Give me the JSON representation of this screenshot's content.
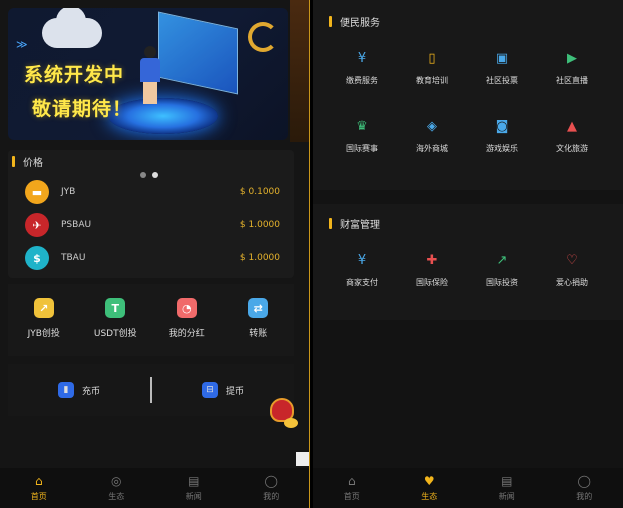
{
  "banner": {
    "line1": "系统开发中",
    "line2": "敬请期待！",
    "slides": 2,
    "active_slide": 1
  },
  "price": {
    "title": "价格",
    "rows": [
      {
        "name": "JYB",
        "price": "$ 0.1000",
        "icon": "jyb-coin-icon",
        "color": "#f2a61c"
      },
      {
        "name": "PSBAU",
        "price": "$ 1.0000",
        "icon": "psbau-coin-icon",
        "color": "#c8262a"
      },
      {
        "name": "TBAU",
        "price": "$ 1.0000",
        "icon": "tbau-coin-icon",
        "color": "#1fb3c9"
      }
    ]
  },
  "quick_actions": [
    {
      "label": "JYB创投",
      "icon": "chart-icon",
      "color": "#f0c23a",
      "glyph": "↗"
    },
    {
      "label": "USDT创投",
      "icon": "tether-icon",
      "color": "#3ebf7a",
      "glyph": "T"
    },
    {
      "label": "我的分红",
      "icon": "pie-icon",
      "color": "#f06a6a",
      "glyph": "◔"
    },
    {
      "label": "转账",
      "icon": "transfer-icon",
      "color": "#4aa8e8",
      "glyph": "⇄"
    }
  ],
  "recharge": {
    "deposit_label": "充币",
    "withdraw_label": "提币"
  },
  "left_tabs": [
    {
      "label": "首页",
      "icon": "home-icon",
      "glyph": "⌂",
      "active": true
    },
    {
      "label": "生态",
      "icon": "ecology-icon",
      "glyph": "◎",
      "active": false
    },
    {
      "label": "新闻",
      "icon": "news-icon",
      "glyph": "▤",
      "active": false
    },
    {
      "label": "我的",
      "icon": "user-icon",
      "glyph": "◯",
      "active": false
    }
  ],
  "right_tabs": [
    {
      "label": "首页",
      "icon": "home-icon",
      "glyph": "⌂",
      "active": false
    },
    {
      "label": "生态",
      "icon": "ecology-icon",
      "glyph": "♥",
      "active": true
    },
    {
      "label": "新闻",
      "icon": "news-icon",
      "glyph": "▤",
      "active": false
    },
    {
      "label": "我的",
      "icon": "user-icon",
      "glyph": "◯",
      "active": false
    }
  ],
  "services": {
    "title": "便民服务",
    "items": [
      {
        "label": "缴费服务",
        "icon": "payment-icon",
        "glyph": "¥",
        "color": "#4aa8e8"
      },
      {
        "label": "教育培训",
        "icon": "book-icon",
        "glyph": "▯",
        "color": "#f2b51c"
      },
      {
        "label": "社区投票",
        "icon": "vote-icon",
        "glyph": "▣",
        "color": "#4aa8e8"
      },
      {
        "label": "社区直播",
        "icon": "live-icon",
        "glyph": "▶",
        "color": "#3ebf7a"
      },
      {
        "label": "国际赛事",
        "icon": "trophy-icon",
        "glyph": "♛",
        "color": "#3ebf7a"
      },
      {
        "label": "海外商城",
        "icon": "shop-icon",
        "glyph": "◈",
        "color": "#4aa8e8"
      },
      {
        "label": "游戏娱乐",
        "icon": "gamepad-icon",
        "glyph": "◙",
        "color": "#4aa8e8"
      },
      {
        "label": "文化旅游",
        "icon": "travel-icon",
        "glyph": "▲",
        "color": "#e85050"
      }
    ]
  },
  "wealth": {
    "title": "财富管理",
    "items": [
      {
        "label": "商家支付",
        "icon": "merchant-pay-icon",
        "glyph": "¥",
        "color": "#4aa8e8"
      },
      {
        "label": "国际保险",
        "icon": "insurance-icon",
        "glyph": "✚",
        "color": "#e85050"
      },
      {
        "label": "国际投资",
        "icon": "investment-icon",
        "glyph": "↗",
        "color": "#3ebf7a"
      },
      {
        "label": "爱心捐助",
        "icon": "heart-icon",
        "glyph": "♡",
        "color": "#e85050"
      }
    ]
  }
}
